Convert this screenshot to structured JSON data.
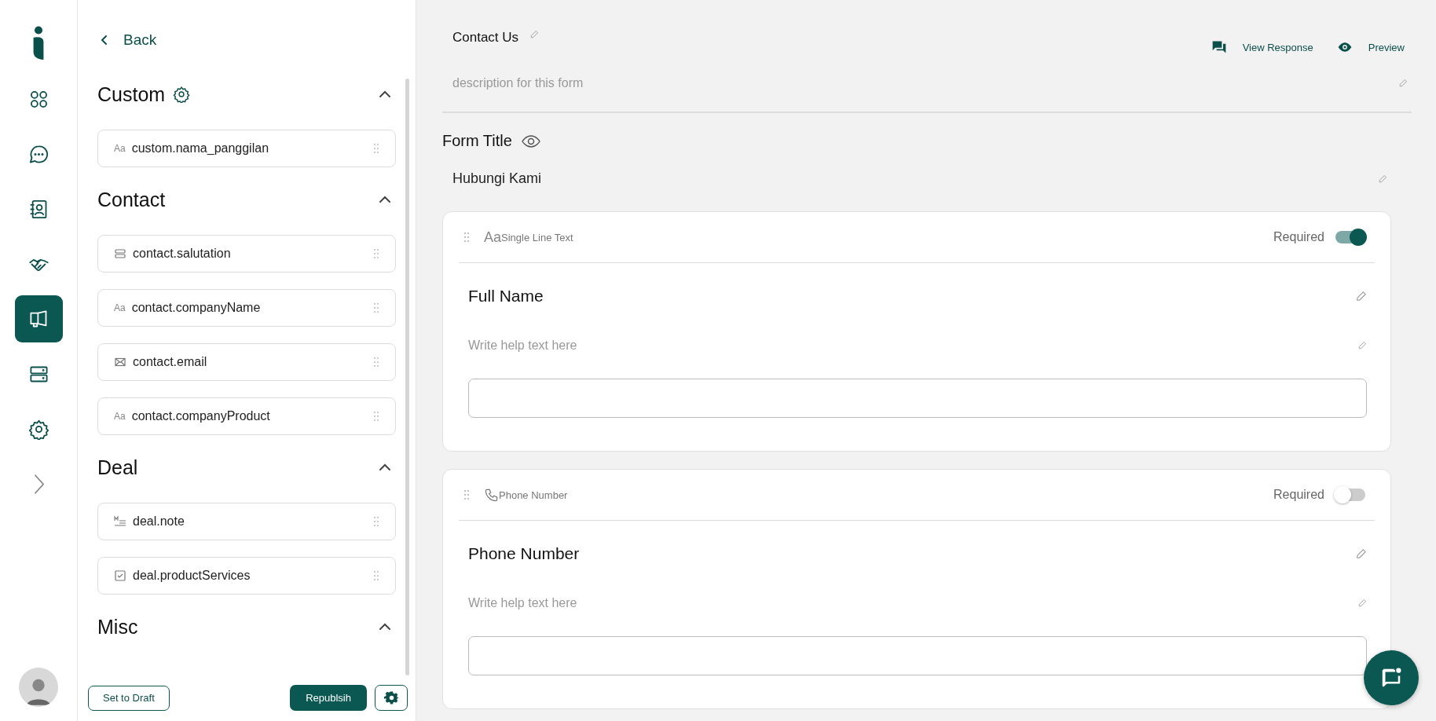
{
  "rail": {
    "items": [
      {
        "kind": "grid",
        "selected": false
      },
      {
        "kind": "chat",
        "selected": false
      },
      {
        "kind": "contacts",
        "selected": false
      },
      {
        "kind": "handshake",
        "selected": false
      },
      {
        "kind": "megaphone",
        "selected": true
      },
      {
        "kind": "server",
        "selected": false
      },
      {
        "kind": "settings",
        "selected": false
      },
      {
        "kind": "chevron",
        "selected": false
      }
    ]
  },
  "panel": {
    "back": "Back",
    "sections": [
      {
        "title": "Custom",
        "settings": true,
        "expanded": true,
        "items": [
          {
            "kind": "text",
            "glyph": "Aa",
            "label": "custom.nama_panggilan"
          }
        ]
      },
      {
        "title": "Contact",
        "settings": false,
        "expanded": true,
        "items": [
          {
            "kind": "select",
            "label": "contact.salutation"
          },
          {
            "kind": "text",
            "glyph": "Aa",
            "label": "contact.companyName"
          },
          {
            "kind": "email",
            "label": "contact.email"
          },
          {
            "kind": "text",
            "glyph": "Aa",
            "label": "contact.companyProduct"
          }
        ]
      },
      {
        "title": "Deal",
        "settings": false,
        "expanded": true,
        "items": [
          {
            "kind": "markdown",
            "label": "deal.note"
          },
          {
            "kind": "checkbox",
            "label": "deal.productServices"
          }
        ]
      },
      {
        "title": "Misc",
        "settings": false,
        "expanded": true
      }
    ],
    "draft_button": "Set to Draft",
    "publish_button": "Republsih"
  },
  "main": {
    "form_name": "Contact Us",
    "actions": [
      {
        "kind": "responses",
        "label": "View Response"
      },
      {
        "kind": "preview",
        "label": "Preview"
      }
    ],
    "description_placeholder": "description for this form",
    "form_title_label": "Form Title",
    "form_title": "Hubungi Kami",
    "fields": [
      {
        "kind": "text",
        "glyph": "Aa",
        "type_label": "Single Line Text",
        "required_label": "Required",
        "required": true,
        "label": "Full Name",
        "help_placeholder": "Write help text here"
      },
      {
        "kind": "phone",
        "type_label": "Phone Number",
        "required_label": "Required",
        "required": false,
        "label": "Phone Number",
        "help_placeholder": "Write help text here"
      }
    ]
  }
}
